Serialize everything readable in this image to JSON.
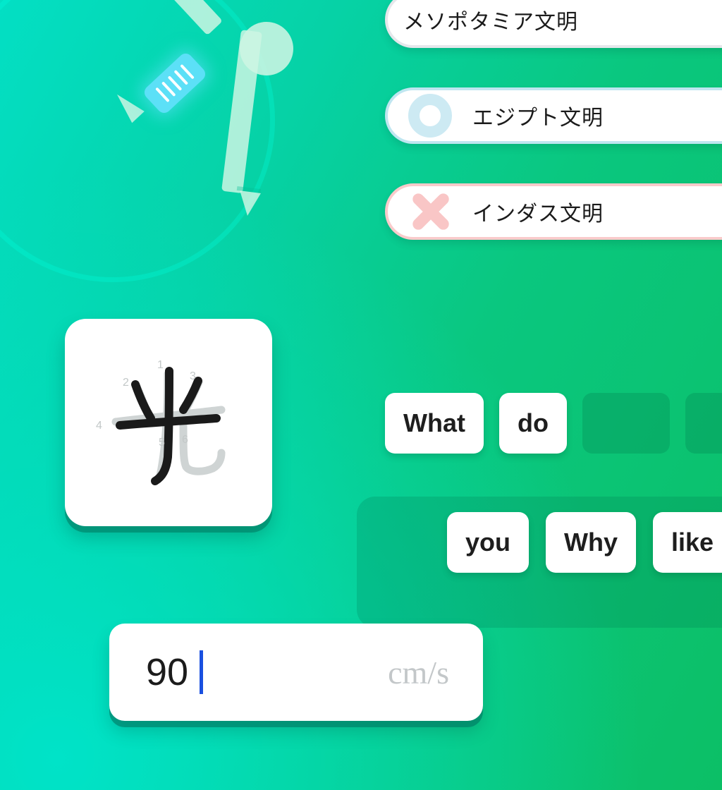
{
  "background": {
    "gradient_from": "#03dfc4",
    "gradient_to": "#0cbf66",
    "accent_cyan": "#5ce0f7"
  },
  "compass": {
    "icon_name": "compass-illustration",
    "grip_color": "#5ce0f7",
    "body_color": "#d7f8e6",
    "arc_color": "#00ffde",
    "grip_tick_count": 5
  },
  "quiz": {
    "options": [
      {
        "label": "メソポタミア文明",
        "state": "neutral",
        "mark": "none",
        "border_color": "#e5e7eb"
      },
      {
        "label": "エジプト文明",
        "state": "selected",
        "mark": "ring",
        "border_color": "#bfe6f0"
      },
      {
        "label": "インダス文明",
        "state": "wrong",
        "mark": "xmark",
        "border_color": "#f9cbcb"
      }
    ]
  },
  "kanji_card": {
    "character": "光",
    "stroke_count": 6,
    "completed_strokes": 4,
    "stroke_numbers": [
      "1",
      "2",
      "3",
      "4",
      "5",
      "6"
    ],
    "done_color": "#1a1a1a",
    "pending_color": "#cfd4d4",
    "number_color": "#c3c8c8"
  },
  "sentence_builder": {
    "answer_slots": [
      {
        "type": "filled",
        "label": "What"
      },
      {
        "type": "filled",
        "label": "do"
      },
      {
        "type": "empty",
        "label": ""
      },
      {
        "type": "empty",
        "label": ""
      }
    ],
    "word_bank": [
      {
        "label": "you"
      },
      {
        "label": "Why"
      },
      {
        "label": "like"
      }
    ]
  },
  "numeric_answer": {
    "value": "90",
    "unit": "cm/s",
    "caret_color": "#1a50e0",
    "unit_color": "#c3c7c9"
  }
}
